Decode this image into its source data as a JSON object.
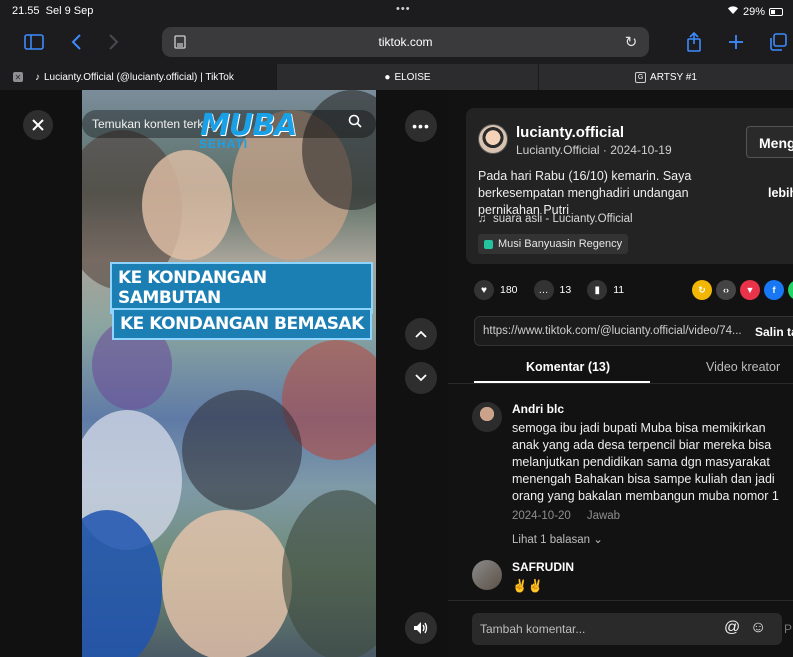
{
  "status": {
    "time": "21.55",
    "date": "Sel 9 Sep",
    "dots": "•••",
    "wifi_icon": "wifi-icon",
    "battery": "29%"
  },
  "browser": {
    "url": "tiktok.com",
    "tabs": [
      {
        "label": "Lucianty.Official (@lucianty.official) | TikTok",
        "active": true
      },
      {
        "label": "ELOISE",
        "active": false
      },
      {
        "label": "ARTSY #1",
        "active": false
      }
    ]
  },
  "video": {
    "search_placeholder": "Temukan konten terkait",
    "logo_text": "MUBA",
    "logo_sub": "SEHATI",
    "caption1": "KE KONDANGAN SAMBUTAN",
    "caption2": "KE KONDANGAN BEMASAK",
    "wrong_mark": "✕",
    "right_mark": "✓"
  },
  "post": {
    "username": "lucianty.official",
    "meta": "Lucianty.Official · 2024-10-19",
    "follow_label": "Mengi",
    "description": "Pada hari Rabu (16/10) kemarin. Saya berkesempatan menghadiri undangan pernikahan Putri",
    "more_label": "lebih ba",
    "music": "suara asli - Lucianty.Official",
    "location": "Musi Banyuasin Regency",
    "likes": "180",
    "comments": "13",
    "saves": "11",
    "link": "https://www.tiktok.com/@lucianty.official/video/74...",
    "copy_label": "Salin tau"
  },
  "tabs": {
    "comments": "Komentar (13)",
    "creator": "Video kreator"
  },
  "comments": [
    {
      "name": "Andri blc",
      "text": "semoga ibu jadi bupati Muba bisa memikirkan anak yang ada desa terpencil biar mereka bisa melanjutkan pendidikan sama dgn masyarakat menengah Bahakan bisa sampe kuliah dan jadi orang yang bakalan membangun muba nomor 1",
      "date": "2024-10-20",
      "reply": "Jawab",
      "replies": "Lihat 1 balasan ⌄"
    },
    {
      "name": "SAFRUDIN",
      "text": "✌️✌️"
    }
  ],
  "compose": {
    "placeholder": "Tambah komentar...",
    "post": "P"
  },
  "colors": {
    "accent": "#3d8bfd",
    "caption_bg": "#1c7fb3",
    "wrong": "#e8333b",
    "right": "#3cbf4a"
  }
}
